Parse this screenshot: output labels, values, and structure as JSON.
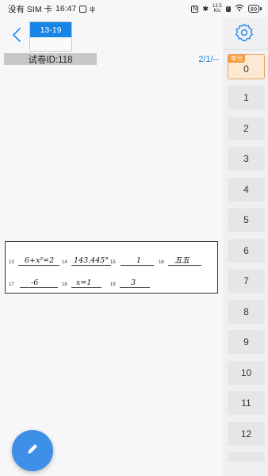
{
  "status_bar": {
    "carrier": "没有 SIM 卡",
    "time": "16:47",
    "net_speed_value": "12.5",
    "net_speed_unit": "K/s",
    "battery": "89"
  },
  "header": {
    "range_label": "13-19",
    "paper_id": "试卷ID:118",
    "page_count": "2/1/--"
  },
  "score_panel": {
    "zero_badge": "零分",
    "zero_label": "0",
    "scores": [
      "1",
      "2",
      "3",
      "4",
      "5",
      "6",
      "7",
      "8",
      "9",
      "10",
      "11",
      "12"
    ]
  },
  "answer_sheet": {
    "row1": [
      {
        "num": "13",
        "answer": "6+x²=2"
      },
      {
        "num": "14",
        "answer": "143.445°"
      },
      {
        "num": "15",
        "answer": "1"
      },
      {
        "num": "16",
        "answer": "五五"
      }
    ],
    "row2": [
      {
        "num": "17",
        "answer": "-6"
      },
      {
        "num": "18",
        "answer": "x=1"
      },
      {
        "num": "19",
        "answer": "3"
      }
    ]
  },
  "icons": {
    "back": "chevron-left-icon",
    "settings": "gear-icon",
    "edit": "pencil-icon"
  },
  "colors": {
    "accent": "#1784e8",
    "zero_badge": "#f59b3c",
    "fab": "#3d8fe8"
  }
}
